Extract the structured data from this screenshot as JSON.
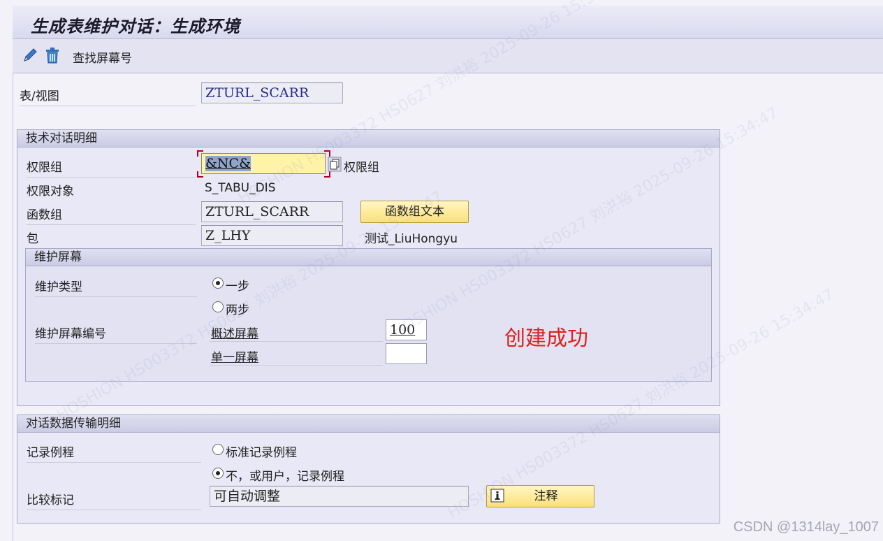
{
  "window": {
    "title": "生成表维护对话：生成环境"
  },
  "toolbar": {
    "edit_icon": "pencil-icon",
    "delete_icon": "trash-icon",
    "find_screen_label": "查找屏幕号"
  },
  "table_view": {
    "label": "表/视图",
    "value": "ZTURL_SCARR"
  },
  "tech_details": {
    "header": "技术对话明细",
    "auth_group_label": "权限组",
    "auth_group_value": "&NC&",
    "auth_group_help_label": "权限组",
    "auth_object_label": "权限对象",
    "auth_object_value": "S_TABU_DIS",
    "function_group_label": "函数组",
    "function_group_value": "ZTURL_SCARR",
    "function_group_text_button": "函数组文本",
    "package_label": "包",
    "package_value": "Z_LHY",
    "package_desc": "测试_LiuHongyu"
  },
  "maintenance_screen": {
    "header": "维护屏幕",
    "type_label": "维护类型",
    "option_one_step": "一步",
    "option_two_step": "两步",
    "selected_type": "一步",
    "screen_number_label": "维护屏幕编号",
    "overview_screen_label": "概述屏幕",
    "overview_screen_value": "100",
    "single_screen_label": "单一屏幕",
    "single_screen_value": ""
  },
  "status_message": {
    "text": "创建成功",
    "color": "#e0201c"
  },
  "data_transport": {
    "header": "对话数据传输明细",
    "recording_routine_label": "记录例程",
    "option_standard": "标准记录例程",
    "option_none": "不，或用户，记录例程",
    "selected_option": "不，或用户，记录例程",
    "compare_flag_label": "比较标记",
    "compare_flag_value": "可自动调整",
    "comment_button": "注释"
  },
  "watermark": {
    "text": "HOSHION HS003372 HS0627 刘洪裕 2025-09-26 15:34:47",
    "csdn": "CSDN @1314lay_1007"
  },
  "colors": {
    "button_yellow": "#fbe07a",
    "focus_field": "#fff3a8",
    "group_bg": "#e8e8f6"
  }
}
